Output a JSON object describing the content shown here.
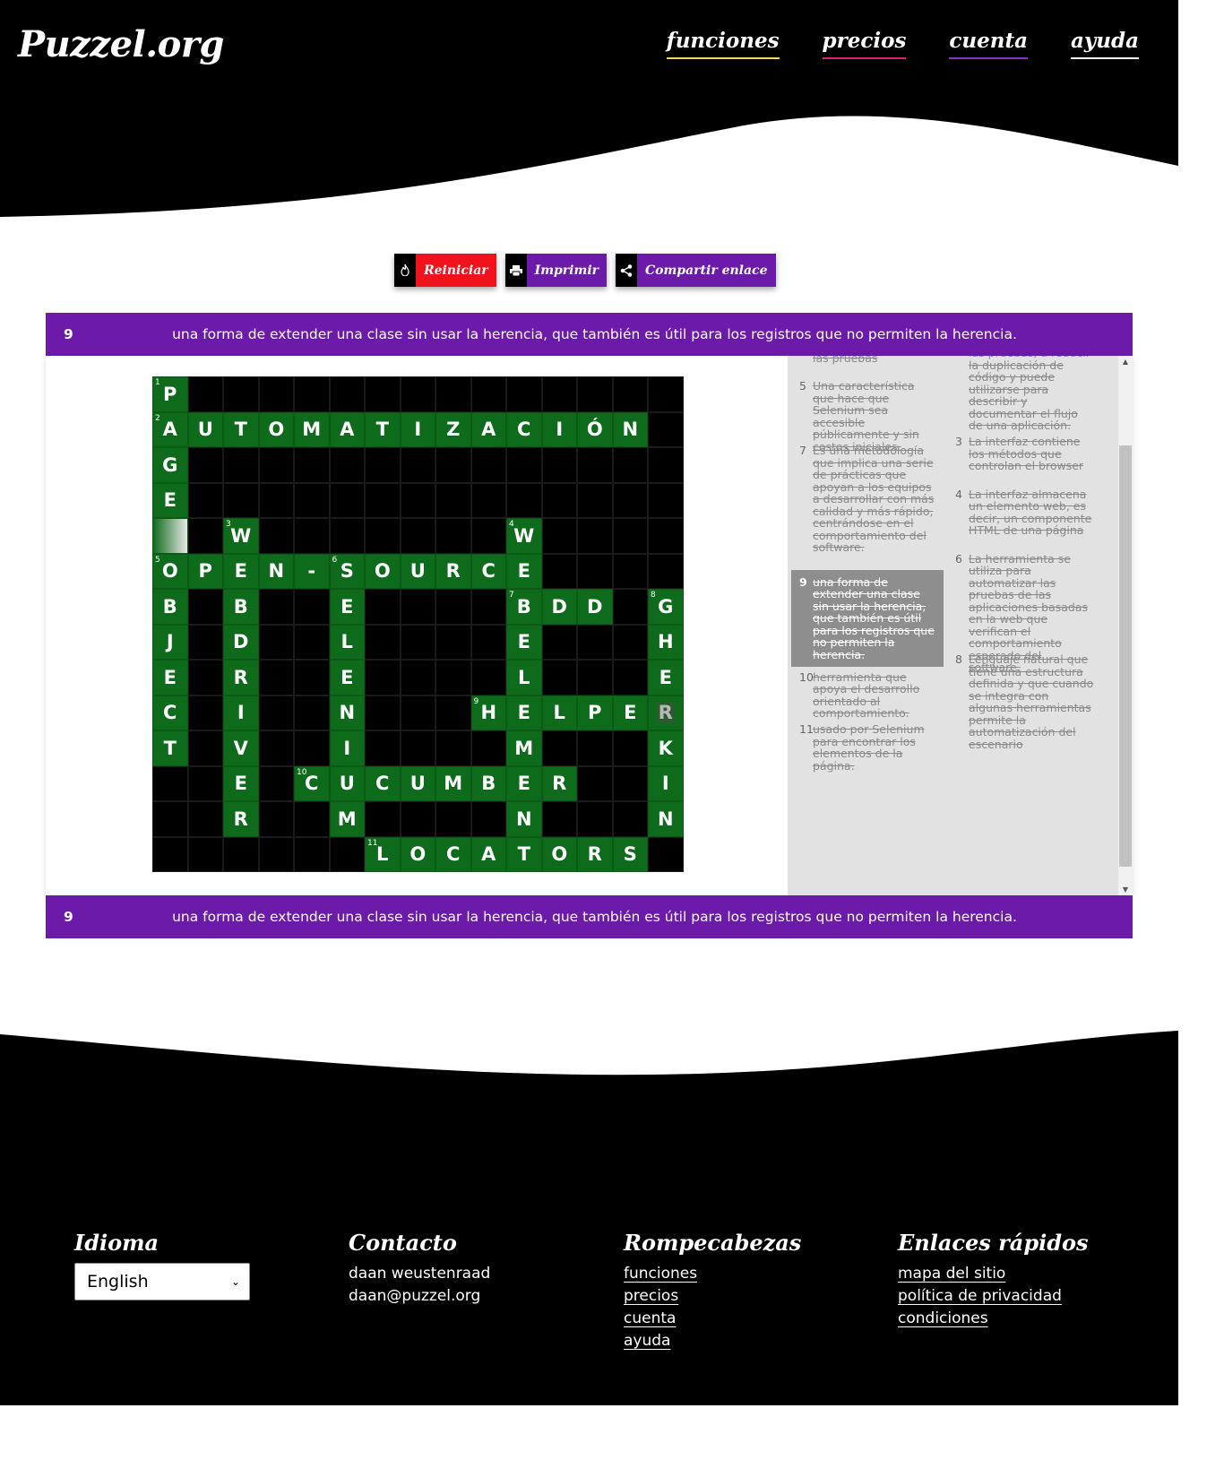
{
  "header": {
    "logo": "Puzzel.org",
    "nav": [
      {
        "label": "funciones",
        "color": "#e8e05a"
      },
      {
        "label": "precios",
        "color": "#d6246e"
      },
      {
        "label": "cuenta",
        "color": "#7b3bc9"
      },
      {
        "label": "ayuda",
        "color": "#ffffff"
      }
    ]
  },
  "toolbar": {
    "reset": {
      "label": "Reiniciar",
      "color": "#f0131b",
      "icon": "flame-icon"
    },
    "print": {
      "label": "Imprimir",
      "color": "#6c1aa9",
      "icon": "printer-icon"
    },
    "share": {
      "label": "Compartir enlace",
      "color": "#6c1aa9",
      "icon": "share-icon"
    }
  },
  "active_clue": {
    "number": "9",
    "text": "una forma de extender una clase sin usar la herencia, que también es útil para los registros que no permiten la herencia."
  },
  "crossword": {
    "grid_rows": 14,
    "grid_cols": 15,
    "entries": [
      {
        "number": 1,
        "answer": "PAGE",
        "row": 0,
        "col": 0,
        "dir": "down"
      },
      {
        "number": 2,
        "answer": "AUTOMATIZACIÓN",
        "row": 1,
        "col": 0,
        "dir": "across"
      },
      {
        "number": 3,
        "answer": "WEBDRIVER",
        "row": 4,
        "col": 2,
        "dir": "down"
      },
      {
        "number": 4,
        "answer": "WEBELEMENT",
        "row": 4,
        "col": 10,
        "dir": "down"
      },
      {
        "number": 5,
        "answer": "OPEN-SOURCE",
        "row": 5,
        "col": 0,
        "dir": "across"
      },
      {
        "number": 5,
        "answer": "OBJECT",
        "row": 5,
        "col": 0,
        "dir": "down"
      },
      {
        "number": 6,
        "answer": "SELENIUM",
        "row": 5,
        "col": 5,
        "dir": "down"
      },
      {
        "number": 7,
        "answer": "BDD",
        "row": 6,
        "col": 10,
        "dir": "across"
      },
      {
        "number": 8,
        "answer": "GHERKIN",
        "row": 6,
        "col": 14,
        "dir": "down"
      },
      {
        "number": 9,
        "answer": "HELPER",
        "row": 9,
        "col": 9,
        "dir": "across"
      },
      {
        "number": 10,
        "answer": "CUCUMBER",
        "row": 11,
        "col": 4,
        "dir": "across"
      },
      {
        "number": 11,
        "answer": "LOCATORS",
        "row": 13,
        "col": 6,
        "dir": "across"
      }
    ],
    "selected_cell": {
      "row": 4,
      "col": 0
    },
    "cursor_cell": {
      "row": 9,
      "col": 14
    }
  },
  "clues_left": [
    {
      "number": "",
      "text": "esfuerzo dedicados a las pruebas"
    },
    {
      "number": "5",
      "text": "Una característica que hace que Selenium sea accesible públicamente y sin costos iniciales."
    },
    {
      "number": "7",
      "text": "Es una metodología que implica una serie de prácticas que apoyan a los equipos a desarrollar con más calidad y más rápido, centrándose en el comportamiento del software."
    },
    {
      "number": "9",
      "text": "una forma de extender una clase sin usar la herencia, que también es útil para los registros que no permiten la herencia.",
      "active": true
    },
    {
      "number": "10",
      "text": "herramienta que apoya el desarrollo orientado al comportamiento."
    },
    {
      "number": "11",
      "text": "usado por Selenium para encontrar los elementos de la página."
    }
  ],
  "clues_right": [
    {
      "number": "",
      "text": "las pruebas, a reducir la duplicación de código y puede utilizarse para describir y documentar el flujo de una aplicación."
    },
    {
      "number": "3",
      "text": "La interfaz contiene los métodos que controlan el browser"
    },
    {
      "number": "4",
      "text": "La interfaz almacena un elemento web, es decir, un componente HTML de una página"
    },
    {
      "number": "6",
      "text": "La herramienta se utiliza para automatizar las pruebas de las aplicaciones basadas en la web que verifican el comportamiento esperado del software."
    },
    {
      "number": "8",
      "text": "Lenguaje natural que tiene una estructura definida y que cuando se integra con algunas herramientas permite la automatización del escenario"
    }
  ],
  "footer": {
    "language": {
      "title": "Idioma",
      "selected": "English"
    },
    "contact": {
      "title": "Contacto",
      "name": "daan weustenraad",
      "email": "daan@puzzel.org"
    },
    "puzzles": {
      "title": "Rompecabezas",
      "links": [
        "funciones",
        "precios",
        "cuenta",
        "ayuda"
      ]
    },
    "quick": {
      "title": "Enlaces rápidos",
      "links": [
        "mapa del sitio",
        "política de privacidad",
        "condiciones"
      ]
    }
  }
}
